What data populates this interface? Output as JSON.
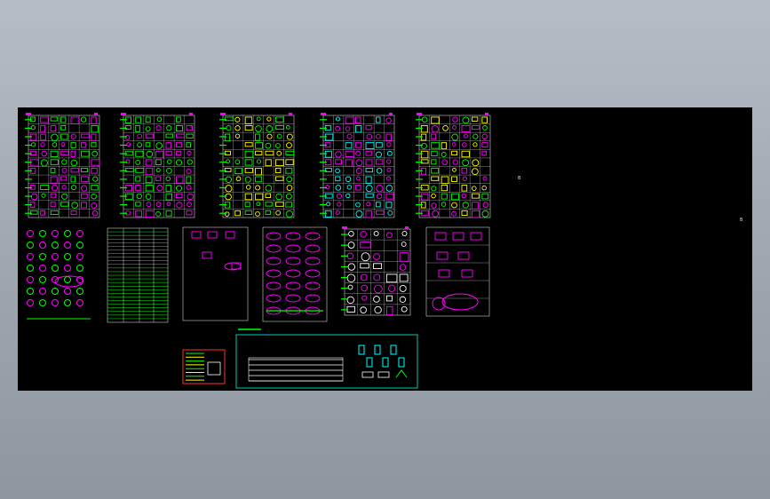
{
  "viewport": {
    "background": "#000000",
    "colors": {
      "magenta": "#ff00ff",
      "green": "#00ff00",
      "yellow": "#ffff00",
      "cyan": "#00ffff",
      "white": "#ffffff",
      "red": "#ff3030",
      "teal_frame": "#00c8b0"
    },
    "sheet_labels": {
      "label_a": "B",
      "label_b": "B"
    },
    "upper_sheets": [
      {
        "name": "sheet-1",
        "title": "",
        "palette": [
          "#ff00ff",
          "#00ff00"
        ]
      },
      {
        "name": "sheet-2",
        "title": "",
        "palette": [
          "#ff00ff",
          "#00ff00"
        ]
      },
      {
        "name": "sheet-3",
        "title": "",
        "palette": [
          "#ffff00",
          "#00ff00"
        ]
      },
      {
        "name": "sheet-4",
        "title": "",
        "palette": [
          "#ff00ff",
          "#00ffff"
        ]
      },
      {
        "name": "sheet-5",
        "title": "",
        "palette": [
          "#ffff00",
          "#ff00ff",
          "#00ff00"
        ]
      }
    ],
    "lower_sheets": [
      {
        "name": "sheet-6",
        "palette": [
          "#ff00ff",
          "#00ff00"
        ]
      },
      {
        "name": "sheet-7",
        "palette": [
          "#00ff00",
          "#ffffff"
        ]
      },
      {
        "name": "sheet-8",
        "palette": [
          "#ff00ff",
          "#ffffff"
        ]
      },
      {
        "name": "sheet-9",
        "palette": [
          "#ff00ff",
          "#00ff00"
        ]
      },
      {
        "name": "sheet-10",
        "palette": [
          "#ff00ff",
          "#ffffff"
        ]
      },
      {
        "name": "sheet-11",
        "palette": [
          "#ff00ff",
          "#ffffff"
        ]
      }
    ],
    "legend_block": {
      "palette": [
        "#ff3030",
        "#00ff00",
        "#ffff00"
      ]
    },
    "bottom_block": {
      "title": "",
      "palette": [
        "#00ffff",
        "#ff00ff",
        "#ffffff"
      ]
    }
  }
}
